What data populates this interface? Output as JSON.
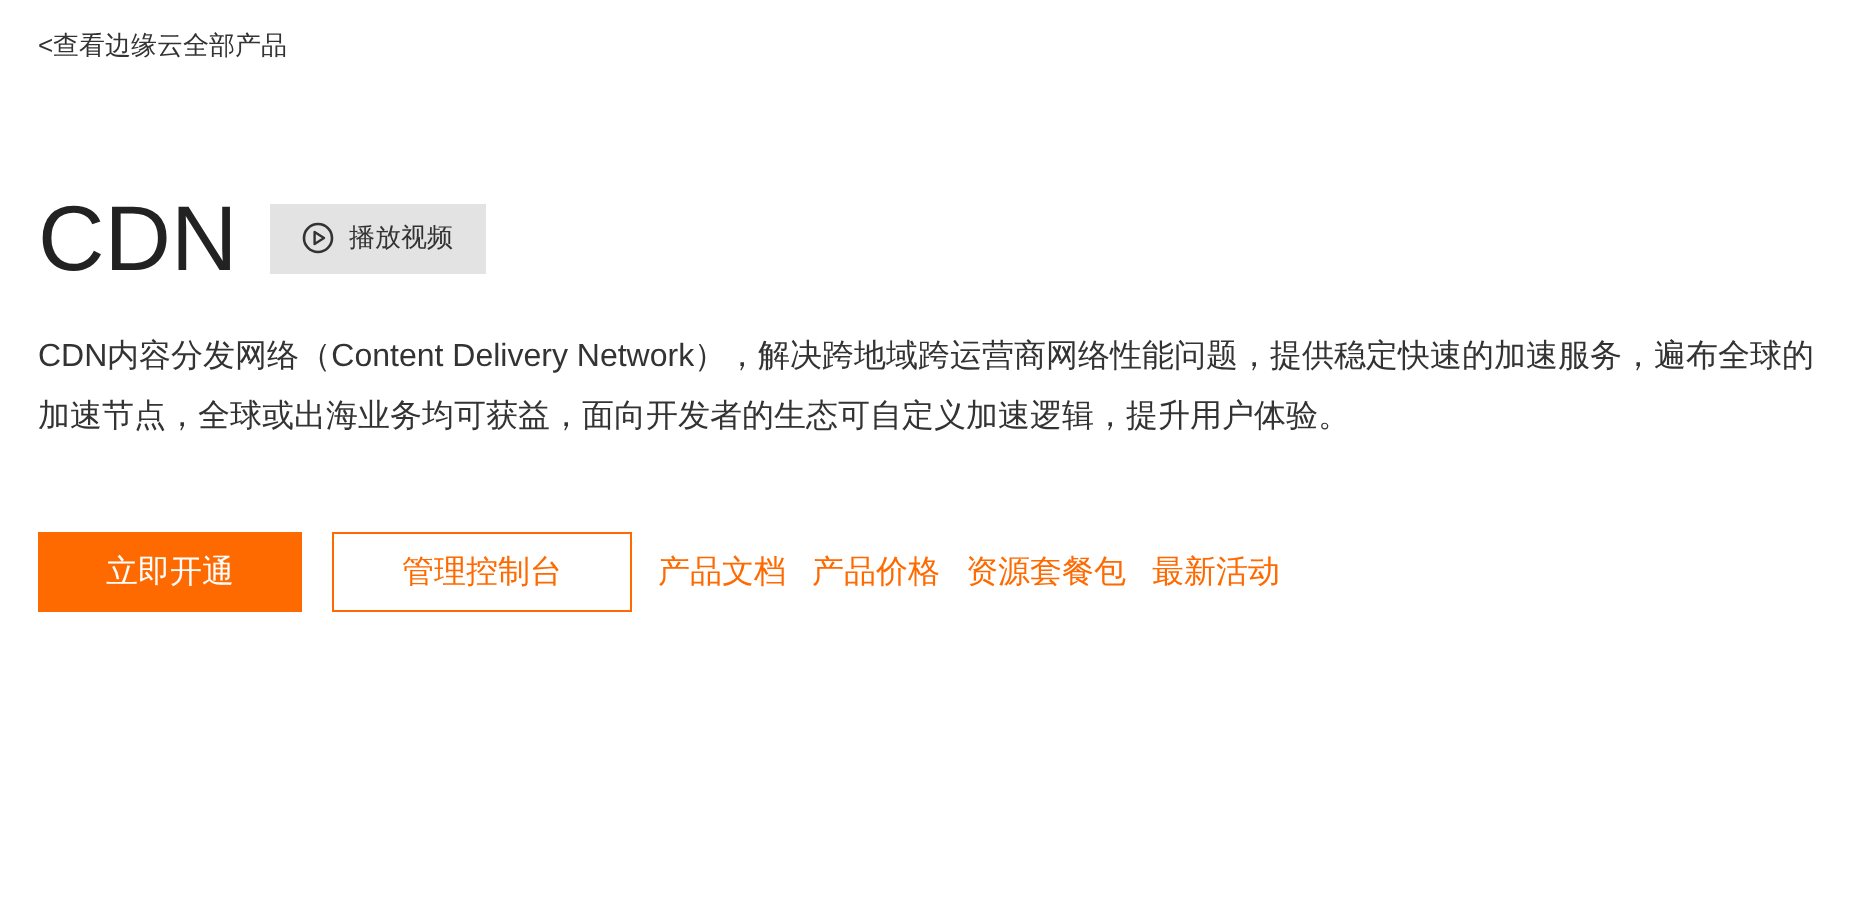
{
  "back_link": "<查看边缘云全部产品",
  "title": "CDN",
  "video_button": "播放视频",
  "description": "CDN内容分发网络（Content Delivery Network），解决跨地域跨运营商网络性能问题，提供稳定快速的加速服务，遍布全球的加速节点，全球或出海业务均可获益，面向开发者的生态可自定义加速逻辑，提升用户体验。",
  "actions": [
    {
      "label": "立即开通",
      "kind": "primary"
    },
    {
      "label": "管理控制台",
      "kind": "outline"
    },
    {
      "label": "产品文档",
      "kind": "link"
    },
    {
      "label": "产品价格",
      "kind": "link"
    },
    {
      "label": "资源套餐包",
      "kind": "link"
    },
    {
      "label": "最新活动",
      "kind": "link"
    }
  ]
}
